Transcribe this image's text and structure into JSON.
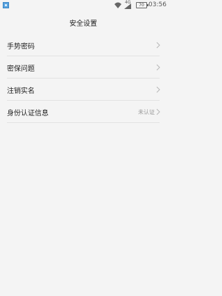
{
  "status_bar": {
    "signal_type": "4G",
    "battery_level": "70",
    "time": "03:56"
  },
  "header": {
    "title": "安全设置"
  },
  "settings": {
    "items": [
      {
        "label": "手势密码",
        "value": ""
      },
      {
        "label": "密保问题",
        "value": ""
      },
      {
        "label": "注销实名",
        "value": ""
      },
      {
        "label": "身份认证信息",
        "value": "未认证"
      }
    ]
  }
}
